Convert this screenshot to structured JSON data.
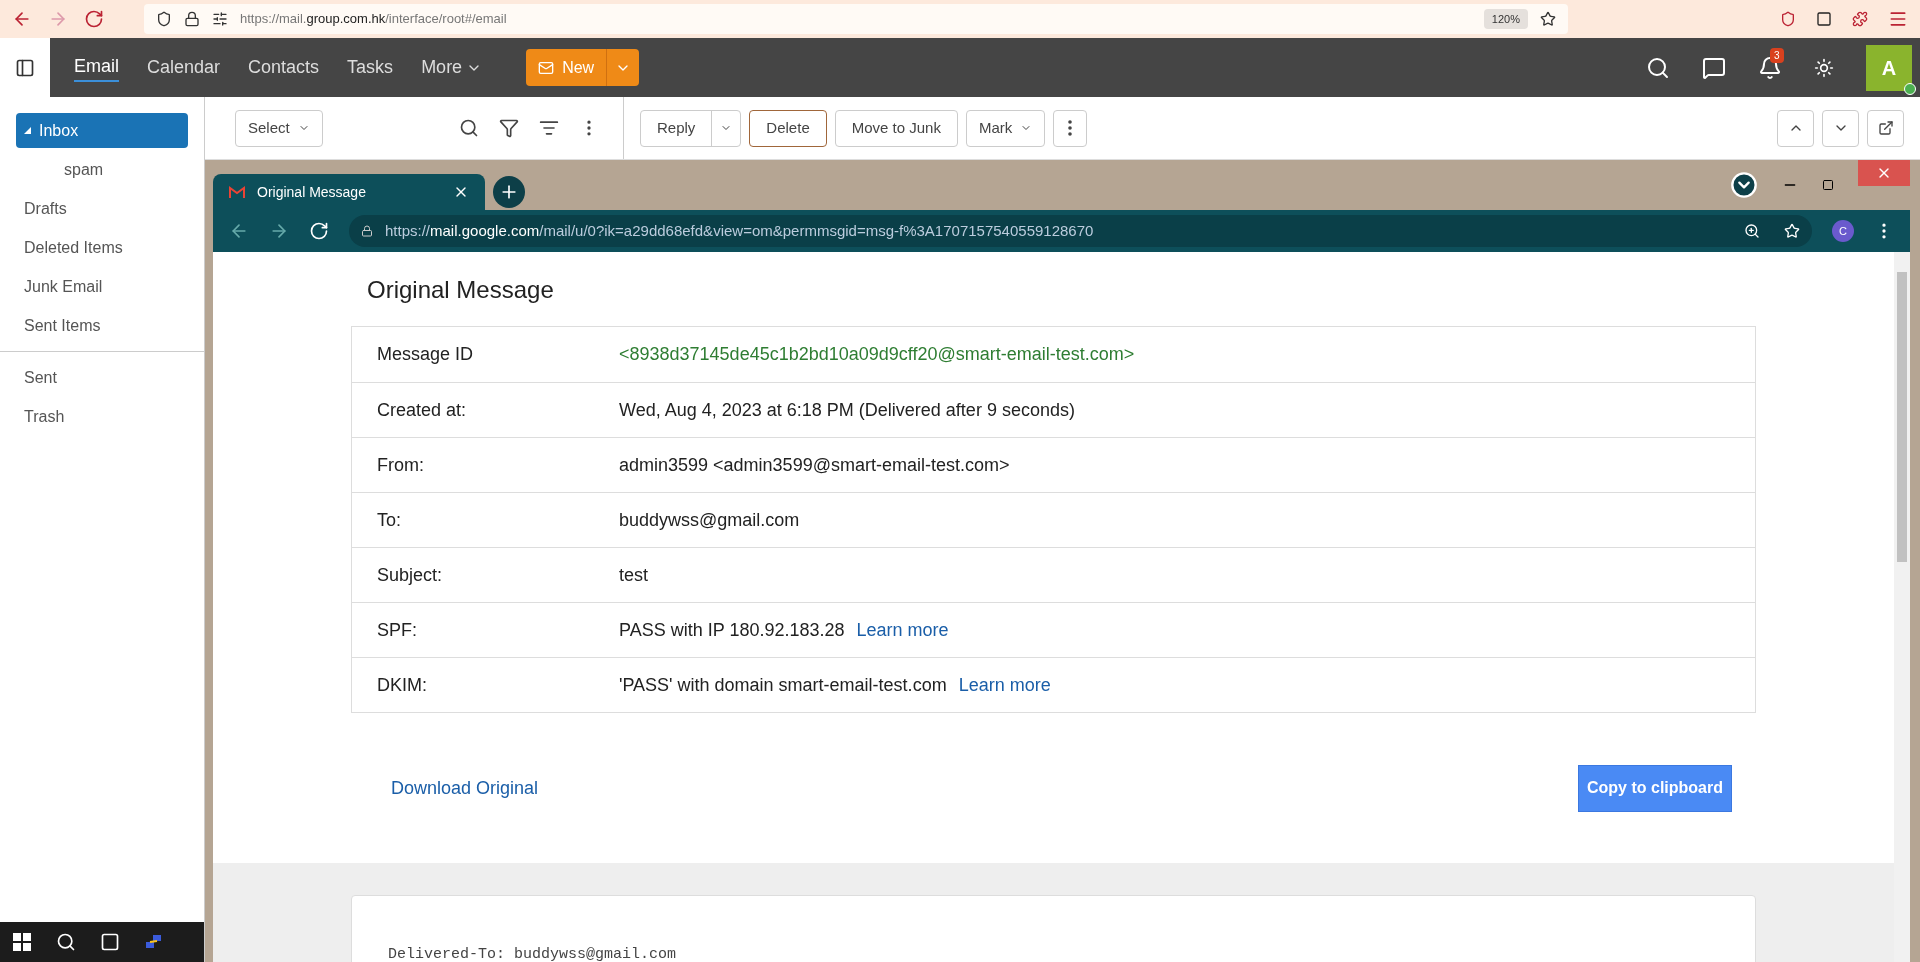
{
  "browser": {
    "url_prefix": "https://mail.",
    "url_host": "group.com.hk",
    "url_path": "/interface/root#/email",
    "zoom": "120%"
  },
  "nav": {
    "tabs": [
      {
        "label": "Email",
        "selected": true
      },
      {
        "label": "Calendar",
        "selected": false
      },
      {
        "label": "Contacts",
        "selected": false
      },
      {
        "label": "Tasks",
        "selected": false
      }
    ],
    "more": "More",
    "new_button": "New",
    "notification_count": "3",
    "avatar": "A"
  },
  "sidebar": {
    "folders": [
      {
        "label": "Inbox",
        "selected": true,
        "expanded": true,
        "children": [
          {
            "label": "spam",
            "selected": false
          }
        ]
      },
      {
        "label": "Drafts",
        "selected": false
      },
      {
        "label": "Deleted Items",
        "selected": false
      },
      {
        "label": "Junk Email",
        "selected": false
      },
      {
        "label": "Sent Items",
        "selected": false
      }
    ],
    "other_folders": [
      {
        "label": "Sent",
        "selected": false
      },
      {
        "label": "Trash",
        "selected": false
      }
    ]
  },
  "toolbar": {
    "select": "Select",
    "reply": "Reply",
    "delete": "Delete",
    "move_to_junk": "Move to Junk",
    "mark": "Mark"
  },
  "inner_browser": {
    "tab_title": "Original Message",
    "url_prefix": "https://",
    "url_host": "mail.google.com",
    "url_path": "/mail/u/0?ik=a29dd68efd&view=om&permmsgid=msg-f%3A1707157540559128670",
    "profile": "C"
  },
  "original_message": {
    "title": "Original Message",
    "rows": [
      {
        "label": "Message ID",
        "value": "<8938d37145de45c1b2bd10a09d9cff20@smart-email-test.com>",
        "kind": "id"
      },
      {
        "label": "Created at:",
        "value": "Wed, Aug 4, 2023 at 6:18 PM (Delivered after 9 seconds)",
        "kind": "plain"
      },
      {
        "label": "From:",
        "value": "admin3599 <admin3599@smart-email-test.com>",
        "kind": "plain"
      },
      {
        "label": "To:",
        "value": "buddywss@gmail.com",
        "kind": "plain"
      },
      {
        "label": "Subject:",
        "value": "test",
        "kind": "plain"
      },
      {
        "label": "SPF:",
        "value": "PASS with IP 180.92.183.28",
        "kind": "link",
        "link": "Learn more"
      },
      {
        "label": "DKIM:",
        "value": "'PASS' with domain smart-email-test.com",
        "kind": "link",
        "link": "Learn more"
      }
    ],
    "download": "Download Original",
    "copy": "Copy to clipboard",
    "raw_first_line": "Delivered-To: buddywss@gmail.com"
  }
}
